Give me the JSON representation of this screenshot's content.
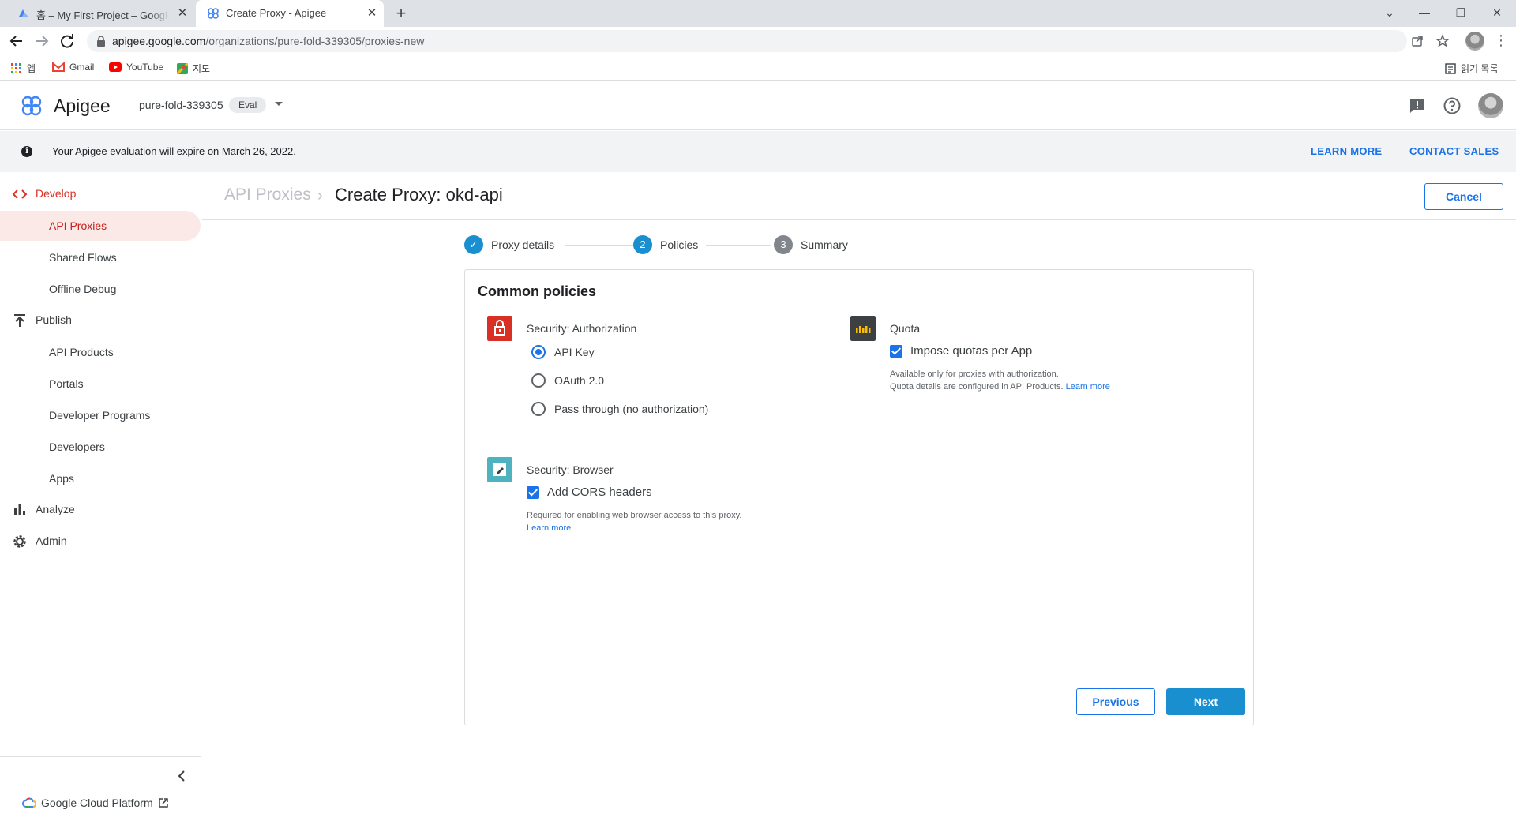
{
  "browser": {
    "tabs": [
      {
        "title": "홈 – My First Project – Google Cloud",
        "close": "✕"
      },
      {
        "title": "Create Proxy - Apigee",
        "close": "✕"
      }
    ],
    "new_tab": "+",
    "url_host": "apigee.google.com",
    "url_path": "/organizations/pure-fold-339305/proxies-new",
    "bookmarks": [
      {
        "label": "앱",
        "icon": "apps-grid-icon"
      },
      {
        "label": "Gmail",
        "icon": "gmail-icon"
      },
      {
        "label": "YouTube",
        "icon": "youtube-icon"
      },
      {
        "label": "지도",
        "icon": "maps-icon"
      }
    ],
    "reading_list": "읽기 목록"
  },
  "header": {
    "brand": "Apigee",
    "org": "pure-fold-339305",
    "env_badge": "Eval"
  },
  "banner": {
    "text": "Your Apigee evaluation will expire on March 26, 2022.",
    "learn_more": "LEARN MORE",
    "contact_sales": "CONTACT SALES"
  },
  "sidebar": {
    "develop": "Develop",
    "develop_items": [
      "API Proxies",
      "Shared Flows",
      "Offline Debug"
    ],
    "publish": "Publish",
    "publish_items": [
      "API Products",
      "Portals",
      "Developer Programs",
      "Developers",
      "Apps"
    ],
    "analyze": "Analyze",
    "admin": "Admin",
    "gcp": "Google Cloud Platform"
  },
  "page": {
    "crumb_parent": "API Proxies",
    "crumb_sep": "›",
    "title": "Create Proxy: okd-api",
    "cancel": "Cancel"
  },
  "stepper": {
    "steps": [
      {
        "number": "✓",
        "label": "Proxy details",
        "state": "done"
      },
      {
        "number": "2",
        "label": "Policies",
        "state": "current"
      },
      {
        "number": "3",
        "label": "Summary",
        "state": "pending"
      }
    ]
  },
  "policies": {
    "card_title": "Common policies",
    "auth": {
      "title": "Security: Authorization",
      "options": [
        "API Key",
        "OAuth 2.0",
        "Pass through (no authorization)"
      ],
      "selected": "API Key"
    },
    "browser": {
      "title": "Security: Browser",
      "cors_label": "Add CORS headers",
      "cors_checked": true,
      "help": "Required for enabling web browser access to this proxy.",
      "learn_more": "Learn more"
    },
    "quota": {
      "title": "Quota",
      "checkbox_label": "Impose quotas per App",
      "checked": true,
      "help_line1": "Available only for proxies with authorization.",
      "help_line2": "Quota details are configured in API Products.",
      "learn_more": "Learn more"
    },
    "previous": "Previous",
    "next": "Next"
  },
  "colors": {
    "accent": "#1a73e8",
    "develop_red": "#d93025",
    "auth_icon": "#d93025",
    "browser_icon": "#4fb3bf",
    "quota_icon": "#3c4043",
    "step_done": "#1a8fd0",
    "step_pending": "#80868b"
  }
}
